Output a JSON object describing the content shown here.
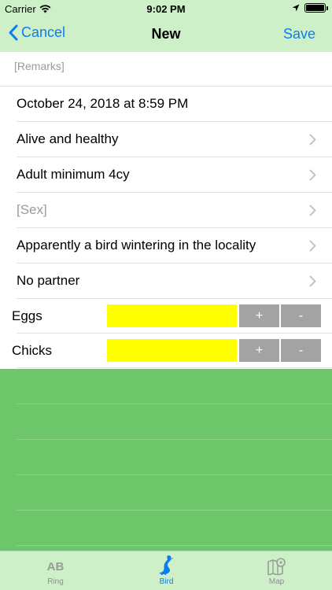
{
  "status": {
    "carrier": "Carrier",
    "time": "9:02 PM"
  },
  "nav": {
    "back_label": "Cancel",
    "title": "New",
    "save_label": "Save"
  },
  "form": {
    "remarks_placeholder": "[Remarks]",
    "rows": [
      {
        "label": "October 24, 2018 at 8:59 PM",
        "placeholder": false,
        "chevron": false
      },
      {
        "label": "Alive and healthy",
        "placeholder": false,
        "chevron": true
      },
      {
        "label": "Adult minimum 4cy",
        "placeholder": false,
        "chevron": true
      },
      {
        "label": "[Sex]",
        "placeholder": true,
        "chevron": true
      },
      {
        "label": "Apparently a bird wintering in the locality",
        "placeholder": false,
        "chevron": true
      },
      {
        "label": "No partner",
        "placeholder": false,
        "chevron": true
      }
    ],
    "counters": [
      {
        "label": "Eggs",
        "plus": "+",
        "minus": "-"
      },
      {
        "label": "Chicks",
        "plus": "+",
        "minus": "-"
      }
    ]
  },
  "tabbar": {
    "tabs": [
      {
        "label": "Ring",
        "icon": "ab-text-icon",
        "icon_text": "AB",
        "active": false
      },
      {
        "label": "Bird",
        "icon": "heron-bird-icon",
        "active": true
      },
      {
        "label": "Map",
        "icon": "map-pin-icon",
        "active": false
      }
    ]
  },
  "colors": {
    "accent": "#0d7cf2",
    "bar_background": "#cdf0c9",
    "counter_value": "#ffff00",
    "counter_button": "#a3a3a3",
    "map_area": "#6ec66a"
  }
}
